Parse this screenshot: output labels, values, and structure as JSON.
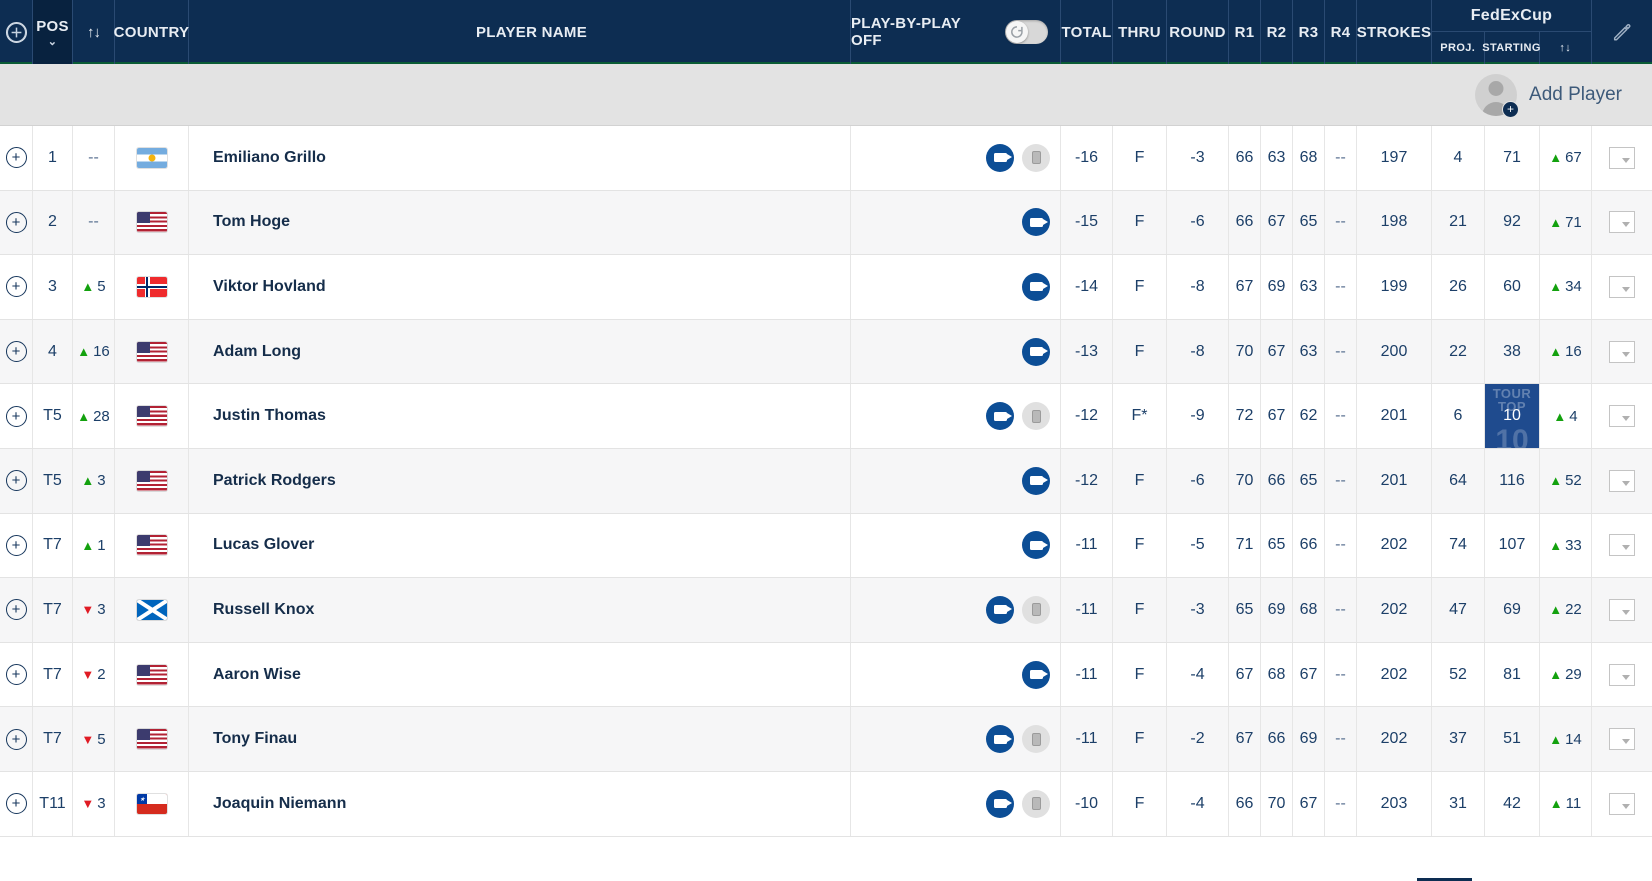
{
  "header": {
    "expand_icon": "⊕",
    "pos_label": "POS",
    "pos_caret": "⌄",
    "move_arrows": "↑↓",
    "country_label": "COUNTRY",
    "player_label": "PLAYER NAME",
    "play_by_play_label": "PLAY-BY-PLAY OFF",
    "play_by_play_state": "off",
    "toggle_icon": "↻",
    "total_label": "TOTAL",
    "thru_label": "THRU",
    "round_label": "ROUND",
    "r1_label": "R1",
    "r2_label": "R2",
    "r3_label": "R3",
    "r4_label": "R4",
    "strokes_label": "STROKES",
    "fedex_label": "FedExCup",
    "fedex_proj_label": "PROJ.",
    "fedex_starting_label": "STARTING",
    "fedex_move_arrows": "↑↓",
    "edit_icon": "✎",
    "colors": {
      "header_bg": "#0d2d52",
      "header_accent": "#0a5c36",
      "pos_cell_bg": "#08223f",
      "up_green": "#13a10e",
      "down_red": "#e01b24",
      "video_blue": "#0c4e96",
      "badge_blue": "#1f4b8e"
    }
  },
  "add_player": {
    "label": "Add Player",
    "avatar_icon": "avatar-placeholder",
    "badge_icon": "+"
  },
  "rows": [
    {
      "expand": "⊕",
      "pos": "1",
      "move_dir": "none",
      "move": "--",
      "country": "arg",
      "country_name": "Argentina",
      "player": "Emiliano Grillo",
      "video": true,
      "phone": true,
      "total": "-16",
      "thru": "F",
      "round": "-3",
      "r1": "66",
      "r2": "63",
      "r3": "68",
      "r4": "--",
      "strokes": "197",
      "fed_proj": "4",
      "fed_starting": "71",
      "fed_badge": false,
      "fed_move_dir": "up",
      "fed_move": "67"
    },
    {
      "expand": "⊕",
      "pos": "2",
      "move_dir": "none",
      "move": "--",
      "country": "usa",
      "country_name": "United States",
      "player": "Tom Hoge",
      "video": true,
      "phone": false,
      "total": "-15",
      "thru": "F",
      "round": "-6",
      "r1": "66",
      "r2": "67",
      "r3": "65",
      "r4": "--",
      "strokes": "198",
      "fed_proj": "21",
      "fed_starting": "92",
      "fed_badge": false,
      "fed_move_dir": "up",
      "fed_move": "71"
    },
    {
      "expand": "⊕",
      "pos": "3",
      "move_dir": "up",
      "move": "5",
      "country": "nor",
      "country_name": "Norway",
      "player": "Viktor Hovland",
      "video": true,
      "phone": false,
      "total": "-14",
      "thru": "F",
      "round": "-8",
      "r1": "67",
      "r2": "69",
      "r3": "63",
      "r4": "--",
      "strokes": "199",
      "fed_proj": "26",
      "fed_starting": "60",
      "fed_badge": false,
      "fed_move_dir": "up",
      "fed_move": "34"
    },
    {
      "expand": "⊕",
      "pos": "4",
      "move_dir": "up",
      "move": "16",
      "country": "usa",
      "country_name": "United States",
      "player": "Adam Long",
      "video": true,
      "phone": false,
      "total": "-13",
      "thru": "F",
      "round": "-8",
      "r1": "70",
      "r2": "67",
      "r3": "63",
      "r4": "--",
      "strokes": "200",
      "fed_proj": "22",
      "fed_starting": "38",
      "fed_badge": false,
      "fed_move_dir": "up",
      "fed_move": "16"
    },
    {
      "expand": "⊕",
      "pos": "T5",
      "move_dir": "up",
      "move": "28",
      "country": "usa",
      "country_name": "United States",
      "player": "Justin Thomas",
      "video": true,
      "phone": true,
      "total": "-12",
      "thru": "F*",
      "round": "-9",
      "r1": "72",
      "r2": "67",
      "r3": "62",
      "r4": "--",
      "strokes": "201",
      "fed_proj": "6",
      "fed_starting": "10",
      "fed_badge": true,
      "fed_badge_top": "TOUR",
      "fed_badge_mid": "TOP",
      "fed_badge_mark": "10",
      "fed_move_dir": "up",
      "fed_move": "4"
    },
    {
      "expand": "⊕",
      "pos": "T5",
      "move_dir": "up",
      "move": "3",
      "country": "usa",
      "country_name": "United States",
      "player": "Patrick Rodgers",
      "video": true,
      "phone": false,
      "total": "-12",
      "thru": "F",
      "round": "-6",
      "r1": "70",
      "r2": "66",
      "r3": "65",
      "r4": "--",
      "strokes": "201",
      "fed_proj": "64",
      "fed_starting": "116",
      "fed_badge": false,
      "fed_move_dir": "up",
      "fed_move": "52"
    },
    {
      "expand": "⊕",
      "pos": "T7",
      "move_dir": "up",
      "move": "1",
      "country": "usa",
      "country_name": "United States",
      "player": "Lucas Glover",
      "video": true,
      "phone": false,
      "total": "-11",
      "thru": "F",
      "round": "-5",
      "r1": "71",
      "r2": "65",
      "r3": "66",
      "r4": "--",
      "strokes": "202",
      "fed_proj": "74",
      "fed_starting": "107",
      "fed_badge": false,
      "fed_move_dir": "up",
      "fed_move": "33"
    },
    {
      "expand": "⊕",
      "pos": "T7",
      "move_dir": "down",
      "move": "3",
      "country": "sco",
      "country_name": "Scotland",
      "player": "Russell Knox",
      "video": true,
      "phone": true,
      "total": "-11",
      "thru": "F",
      "round": "-3",
      "r1": "65",
      "r2": "69",
      "r3": "68",
      "r4": "--",
      "strokes": "202",
      "fed_proj": "47",
      "fed_starting": "69",
      "fed_badge": false,
      "fed_move_dir": "up",
      "fed_move": "22"
    },
    {
      "expand": "⊕",
      "pos": "T7",
      "move_dir": "down",
      "move": "2",
      "country": "usa",
      "country_name": "United States",
      "player": "Aaron Wise",
      "video": true,
      "phone": false,
      "total": "-11",
      "thru": "F",
      "round": "-4",
      "r1": "67",
      "r2": "68",
      "r3": "67",
      "r4": "--",
      "strokes": "202",
      "fed_proj": "52",
      "fed_starting": "81",
      "fed_badge": false,
      "fed_move_dir": "up",
      "fed_move": "29"
    },
    {
      "expand": "⊕",
      "pos": "T7",
      "move_dir": "down",
      "move": "5",
      "country": "usa",
      "country_name": "United States",
      "player": "Tony Finau",
      "video": true,
      "phone": true,
      "total": "-11",
      "thru": "F",
      "round": "-2",
      "r1": "67",
      "r2": "66",
      "r3": "69",
      "r4": "--",
      "strokes": "202",
      "fed_proj": "37",
      "fed_starting": "51",
      "fed_badge": false,
      "fed_move_dir": "up",
      "fed_move": "14"
    },
    {
      "expand": "⊕",
      "pos": "T11",
      "move_dir": "down",
      "move": "3",
      "country": "chi",
      "country_name": "Chile",
      "player": "Joaquin Niemann",
      "video": true,
      "phone": true,
      "total": "-10",
      "thru": "F",
      "round": "-4",
      "r1": "66",
      "r2": "70",
      "r3": "67",
      "r4": "--",
      "strokes": "203",
      "fed_proj": "31",
      "fed_starting": "42",
      "fed_badge": false,
      "fed_move_dir": "up",
      "fed_move": "11"
    }
  ]
}
